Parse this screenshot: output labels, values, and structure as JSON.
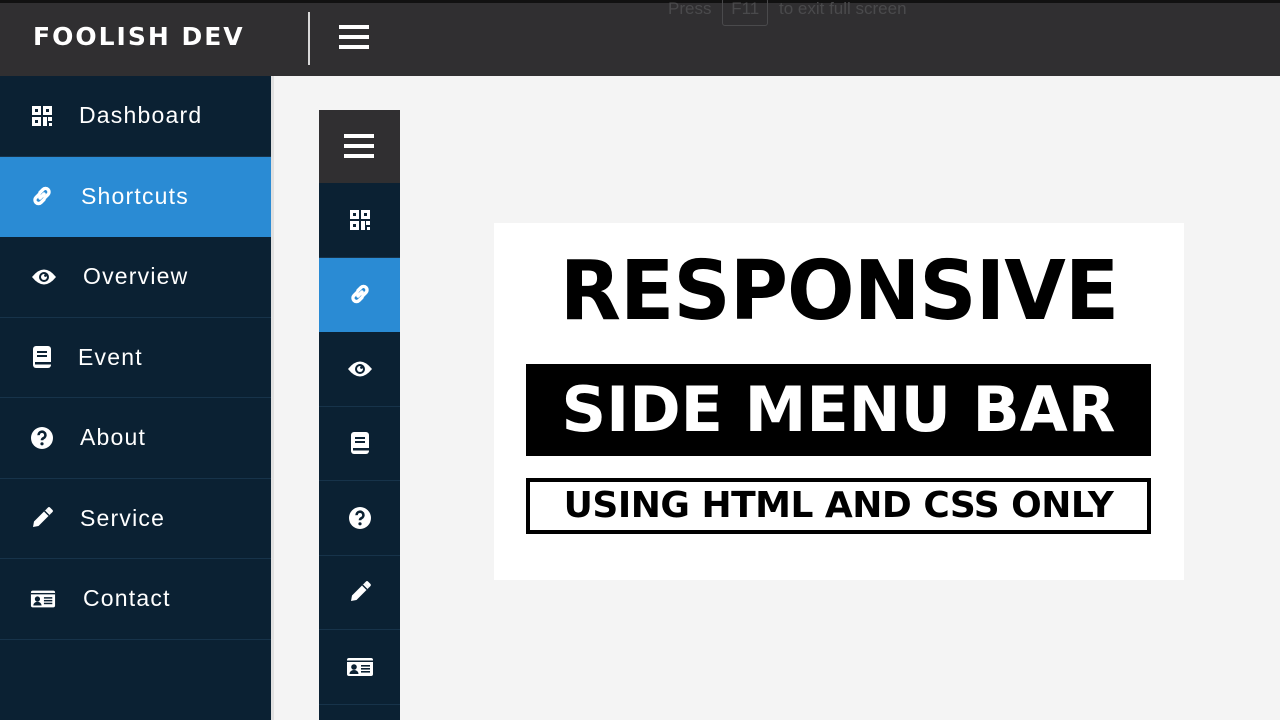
{
  "header": {
    "brand": "FOOLISH DEV",
    "menu_icon": "hamburger-icon",
    "fullscreen_hint": {
      "prefix": "Press",
      "key": "F11",
      "suffix": "to exit full screen"
    }
  },
  "sidebar": {
    "active_index": 1,
    "items": [
      {
        "label": "Dashboard",
        "icon": "qrcode-icon"
      },
      {
        "label": "Shortcuts",
        "icon": "link-icon"
      },
      {
        "label": "Overview",
        "icon": "eye-icon"
      },
      {
        "label": "Event",
        "icon": "book-icon"
      },
      {
        "label": "About",
        "icon": "question-circle-icon"
      },
      {
        "label": "Service",
        "icon": "pencil-icon"
      },
      {
        "label": "Contact",
        "icon": "id-card-icon"
      }
    ]
  },
  "mini_sidebar": {
    "menu_icon": "hamburger-icon",
    "active_index": 1
  },
  "banner": {
    "line1": "RESPONSIVE",
    "line2": "SIDE MENU BAR",
    "line3": "USING HTML AND CSS ONLY"
  },
  "colors": {
    "topbar": "#302f31",
    "sidebar": "#0b2133",
    "active": "#2a8bd4",
    "content_bg": "#f4f4f4"
  }
}
